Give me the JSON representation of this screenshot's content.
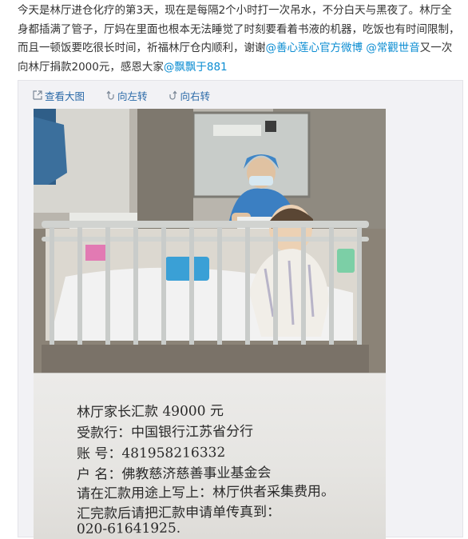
{
  "post": {
    "segment1": "今天是林厅进仓化疗的第3天，现在是每隔2个小时打一次吊水，不分白天与黑夜了。林厅全身都插满了管子，厅妈在里面也根本无法睡觉了时刻要看着书液的机器，吃饭也有时间限制，而且一顿饭要吃很长时间，祈福林厅仓内顺利，谢谢",
    "mention1": "@善心莲心官方微博",
    "mention2": "@常觀世音",
    "segment2": "又一次向林厅捐款2000元，感恩大家",
    "mention3": "@飘飘于881"
  },
  "toolbar": {
    "view_large": "查看大图",
    "rotate_left": "向左转",
    "rotate_right": "向右转"
  },
  "note": {
    "line1": "林厅家长汇款 49000 元",
    "line2": "受款行：中国银行江苏省分行",
    "line3": "账 号：481958216332",
    "line4": "户 名：佛教慈济慈善事业基金会",
    "line5": "请在汇款用途上写上：林厅供者采集费用。",
    "line6": "汇完款后请把汇款申请单传真到：",
    "line7": "020-61641925."
  },
  "colors": {
    "link": "#0a8cd2",
    "toolbar_link": "#2b6aa8",
    "text": "#333333"
  },
  "icons": [
    "expand-icon",
    "rotate-left-icon",
    "rotate-right-icon"
  ]
}
